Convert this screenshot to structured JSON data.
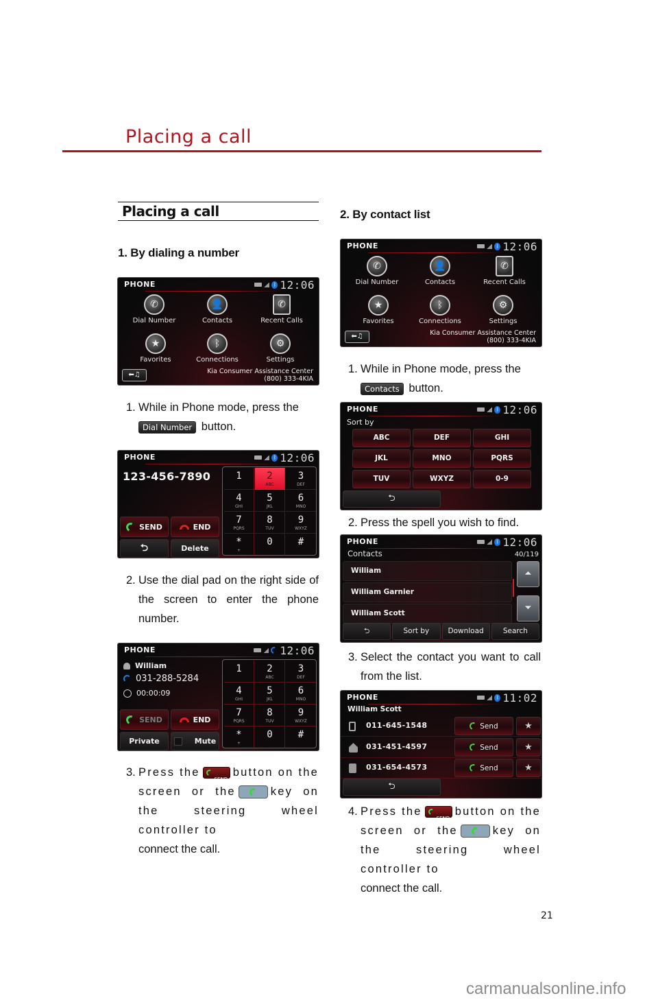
{
  "page": {
    "chapter_title": "Placing a call",
    "section_title": "Placing a call",
    "page_number": "21",
    "watermark": "carmanualsonline.info"
  },
  "left": {
    "heading": "1. By dialing a number",
    "step1": {
      "num": "1.",
      "text_a": "While in Phone mode, press the",
      "button": "Dial Number",
      "text_b": "button."
    },
    "step2": {
      "num": "2.",
      "text": "Use the dial pad on the right side of the screen to enter the phone number."
    },
    "step3": {
      "num": "3.",
      "text_a": "Press the",
      "send_label": "SEND",
      "text_b": "button on the screen or the",
      "text_c": "key on the steering wheel controller to",
      "text_d": "connect the call."
    }
  },
  "right": {
    "heading": "2. By contact list",
    "step1": {
      "num": "1.",
      "text_a": "While in Phone mode, press the",
      "button": "Contacts",
      "text_b": "button."
    },
    "step2": {
      "num": "2.",
      "text": "Press the spell you wish to find."
    },
    "step3": {
      "num": "3.",
      "text": "Select the contact you want to call from the list."
    },
    "step4": {
      "num": "4.",
      "text_a": "Press the",
      "send_label": "SEND",
      "text_b": "button on the screen or the",
      "text_c": "key on the steering wheel controller to",
      "text_d": "connect the call."
    }
  },
  "screens": {
    "header_title": "PHONE",
    "clock": "12:06",
    "clock_detail": "11:02",
    "menu": [
      {
        "label": "Dial Number",
        "icon": "phone-icon"
      },
      {
        "label": "Contacts",
        "icon": "contacts-icon"
      },
      {
        "label": "Recent Calls",
        "icon": "recent-calls-icon"
      },
      {
        "label": "Favorites",
        "icon": "favorites-icon"
      },
      {
        "label": "Connections",
        "icon": "bluetooth-icon"
      },
      {
        "label": "Settings",
        "icon": "gear-icon"
      }
    ],
    "assist_line1": "Kia Consumer Assistance Center",
    "assist_line2": "(800) 333-4KIA",
    "back_media": "⬅♫",
    "dial": {
      "number": "123-456-7890",
      "send": "SEND",
      "end": "END",
      "back": "⮌",
      "delete": "Delete",
      "keys": [
        {
          "d": "1",
          "l": ""
        },
        {
          "d": "2",
          "l": "ABC"
        },
        {
          "d": "3",
          "l": "DEF"
        },
        {
          "d": "4",
          "l": "GHI"
        },
        {
          "d": "5",
          "l": "JKL"
        },
        {
          "d": "6",
          "l": "MNO"
        },
        {
          "d": "7",
          "l": "PQRS"
        },
        {
          "d": "8",
          "l": "TUV"
        },
        {
          "d": "9",
          "l": "WXYZ"
        },
        {
          "d": "*",
          "l": "+"
        },
        {
          "d": "0",
          "l": ""
        },
        {
          "d": "#",
          "l": ""
        }
      ],
      "active_key": "2"
    },
    "call": {
      "name": "William",
      "number": "031-288-5284",
      "duration": "00:00:09",
      "send": "SEND",
      "end": "END",
      "private": "Private",
      "mute": "Mute"
    },
    "sort": {
      "label": "Sort by",
      "options": [
        "ABC",
        "DEF",
        "GHI",
        "JKL",
        "MNO",
        "PQRS",
        "TUV",
        "WXYZ",
        "0-9"
      ]
    },
    "contacts": {
      "title": "Contacts",
      "count": "40/119",
      "rows": [
        "William",
        "William Garnier",
        "William Scott"
      ],
      "bottom": [
        "⮌",
        "Sort by",
        "Download",
        "Search"
      ]
    },
    "detail": {
      "name": "William Scott",
      "rows": [
        {
          "type": "mobile",
          "number": "011-645-1548"
        },
        {
          "type": "home",
          "number": "031-451-4597"
        },
        {
          "type": "office",
          "number": "031-654-4573"
        }
      ],
      "send": "Send",
      "star": "★"
    }
  }
}
